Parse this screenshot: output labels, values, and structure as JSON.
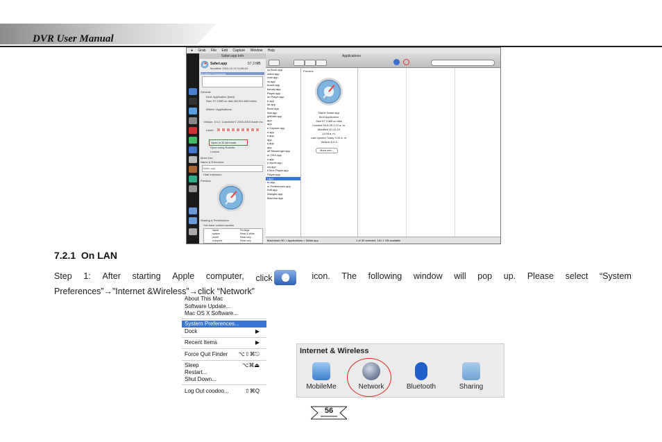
{
  "header": {
    "title": "DVR User Manual"
  },
  "screenshot": {
    "menubar": [
      "Grab",
      "File",
      "Edit",
      "Capture",
      "Window",
      "Help"
    ],
    "info_window": {
      "title": "Safari.app Info",
      "name": "Safari.app",
      "size": "57.3 MB",
      "modified": "Modified: 2010-10-19 11:56:04",
      "spotlight": "Spotlight Comments:",
      "general": "General:",
      "kind": "Kind: Application (Intel)",
      "size_line": "Size: 57.3 MB on disk (48,521,663 bytes)",
      "where": "Where: /Applications",
      "version": "Version: 5.0.2, Copyright © 2003-2010 Apple Inc.",
      "label": "Label:",
      "open_32": "Open in 32-bit mode",
      "open_rosetta": "Open using Rosetta",
      "locked": "Locked",
      "more_info": "More Info:",
      "name_ext": "Name & Extension:",
      "name_value": "Safari.app",
      "hide_ext": "Hide extension",
      "preview": "Preview:",
      "sharing": "Sharing & Permissions:",
      "custom_access": "You have custom access",
      "perm_header": [
        "Name",
        "Privilege"
      ],
      "perm_rows": [
        [
          "system",
          "Read & Write"
        ],
        [
          "wheel",
          "Read only"
        ],
        [
          "everyone",
          "Read only"
        ]
      ]
    },
    "finder": {
      "title": "Applications",
      "apps": [
        "ss Book.app",
        "ulator.app",
        "ndar.app",
        "ss.app",
        "board.app",
        "tionary.app",
        "Player.app",
        "do Player.app",
        "e.app",
        "sh.app",
        "Book.app",
        "llow.app",
        "gelbard.app",
        "app",
        "app",
        "e Capture.app",
        "e.app",
        "s.app",
        "app",
        "s.app",
        "app",
        "oft Messenger.app",
        "er OSX.app",
        "s.app",
        "e Booth.app",
        "ew.app",
        "kTime Player.app",
        "Player.app",
        "i.app",
        "m.app",
        "m Preferences.app",
        "Edit.app",
        "Wangler.app",
        "Machine.app"
      ],
      "selected_index": 28,
      "preview_name": "Name Safari.app",
      "preview_kind": "Kind Application",
      "preview_size": "Size 57.3 MB on disk",
      "preview_created": "Created 09-8-20 1:22 a. m.",
      "preview_modified": "Modified 10-10-19",
      "preview_time": "11:56 a. m.",
      "preview_opened": "Last opened Today 9:34 a. m.",
      "preview_version": "Version 5.0.2",
      "more_info_btn": "More info...",
      "path": "Macintosh HD > Applications > Safari.app",
      "status": "1 of 30 selected, 161.1 GB available"
    }
  },
  "section": {
    "number": "7.2.1",
    "title": "On LAN"
  },
  "paragraph": {
    "w1": "Step",
    "w2": "1:",
    "w3": "After",
    "w4": "starting",
    "w5": "Apple",
    "w6": "computer,",
    "w7": "click",
    "w8": "icon.",
    "w9": "The",
    "w10": "following",
    "w11": "window",
    "w12": "will",
    "w13": "pop",
    "w14": "up.",
    "w15": "Please",
    "w16": "select",
    "w17": "“System",
    "line2": "Preferences”→”Internet &Wireless”→click “Network”"
  },
  "apple_menu": {
    "items": [
      "About This Mac",
      "Software Update...",
      "Mac OS X Software...",
      "System Preferences...",
      "Dock",
      "Recent Items",
      "Force Quit Finder",
      "Sleep",
      "Restart...",
      "Shut Down...",
      "Log Out coodoo..."
    ],
    "shortcuts": {
      "force_quit": "⌥⇧⌘⎋",
      "sleep": "⌥⌘⏏",
      "logout": "⇧⌘Q"
    }
  },
  "internet_wireless": {
    "title": "Internet & Wireless",
    "items": [
      "MobileMe",
      "Network",
      "Bluetooth",
      "Sharing"
    ]
  },
  "page": {
    "number": "56"
  }
}
